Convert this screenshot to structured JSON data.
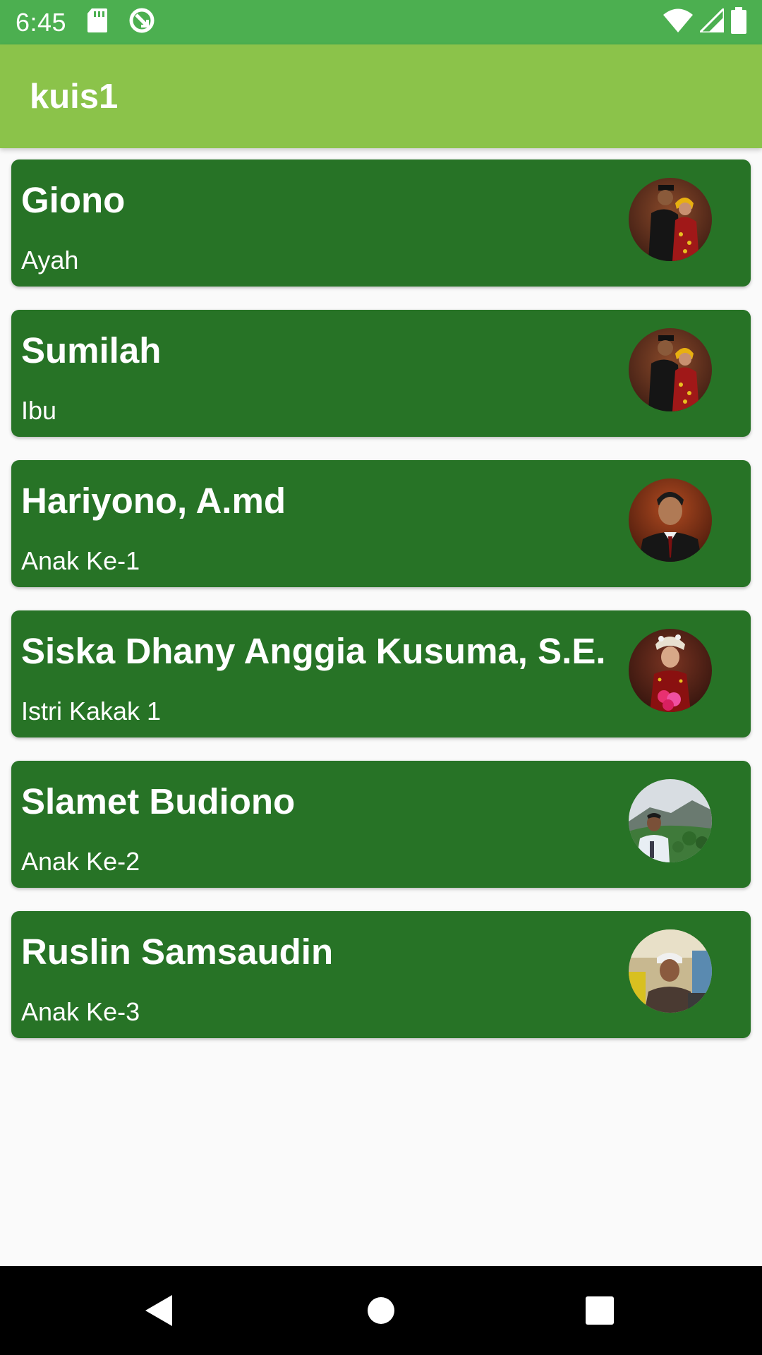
{
  "status_bar": {
    "time": "6:45",
    "icons": [
      "sd-card-icon",
      "sync-icon",
      "wifi-icon",
      "signal-icon",
      "battery-icon"
    ],
    "background": "#4caf50"
  },
  "app_bar": {
    "title": "kuis1",
    "background": "#8bc34a"
  },
  "list": {
    "card_color": "#277326",
    "items": [
      {
        "name": "Giono",
        "role": "Ayah",
        "avatar": "couple-photo-avatar"
      },
      {
        "name": "Sumilah",
        "role": "Ibu",
        "avatar": "couple-photo-avatar"
      },
      {
        "name": "Hariyono, A.md",
        "role": "Anak Ke-1",
        "avatar": "man-in-suit-photo-avatar"
      },
      {
        "name": "Siska Dhany Anggia Kusuma, S.E.",
        "role": "Istri Kakak 1",
        "avatar": "bride-photo-avatar"
      },
      {
        "name": "Slamet Budiono",
        "role": "Anak Ke-2",
        "avatar": "mountain-selfie-photo-avatar"
      },
      {
        "name": "Ruslin Samsaudin",
        "role": "Anak Ke-3",
        "avatar": "indoor-selfie-photo-avatar"
      }
    ]
  },
  "nav_bar": {
    "icons": [
      "back-icon",
      "home-icon",
      "recents-icon"
    ]
  }
}
